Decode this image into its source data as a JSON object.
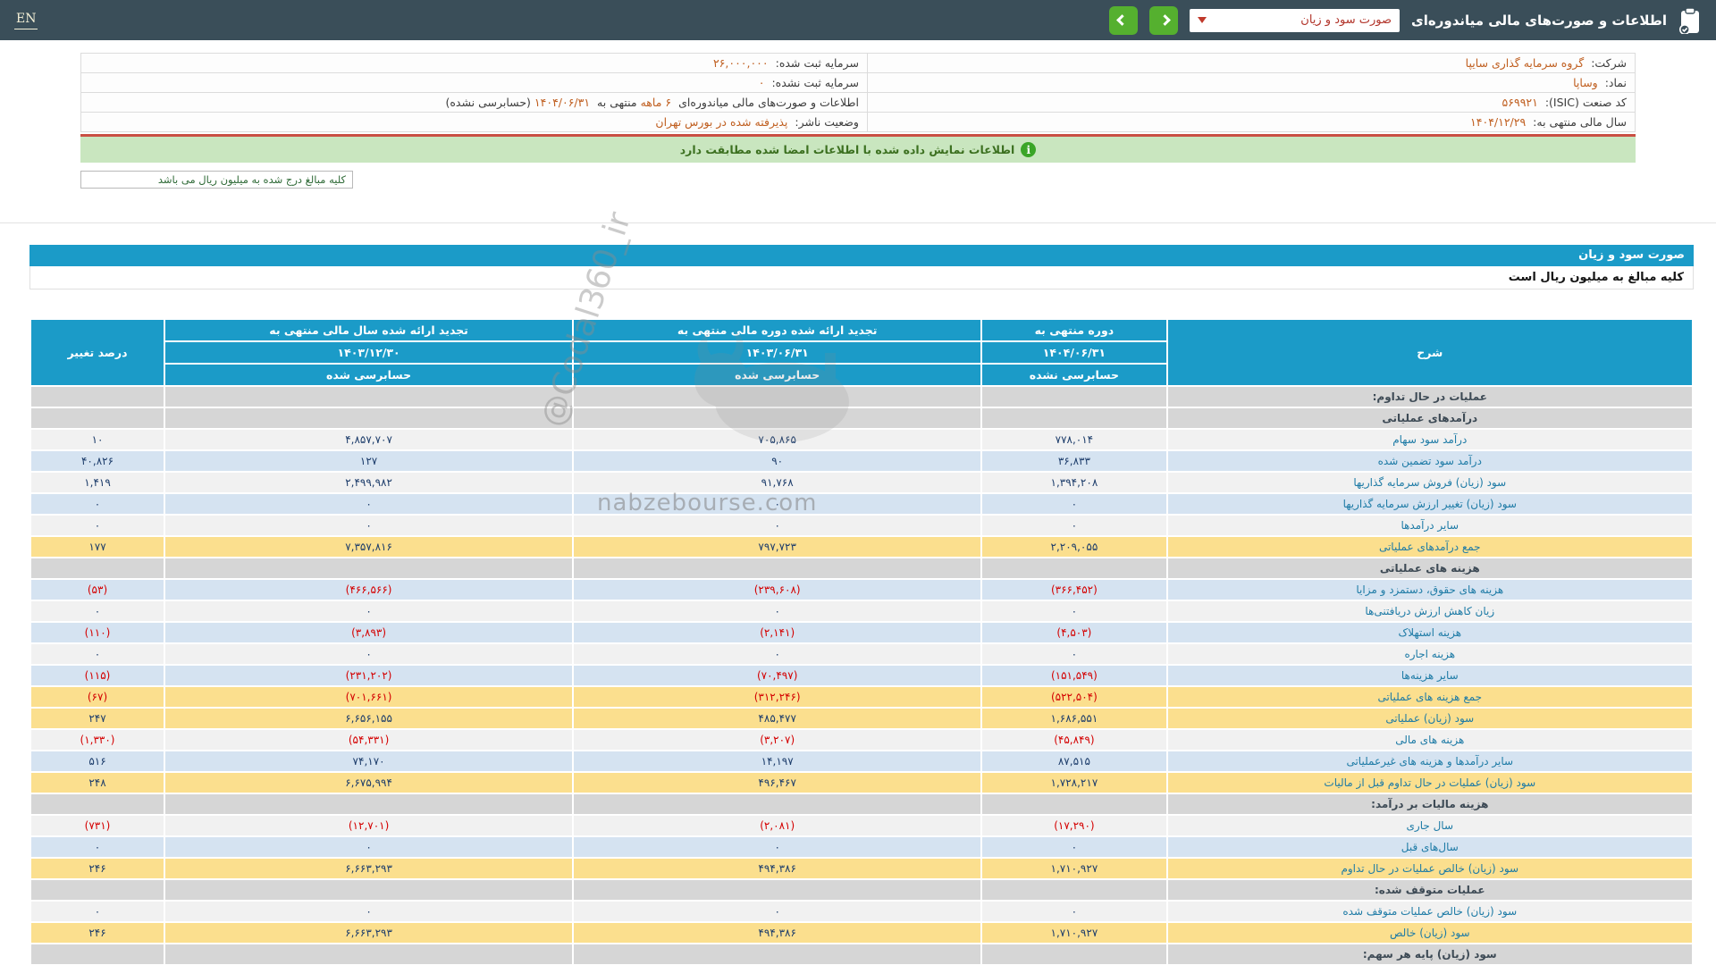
{
  "topbar": {
    "lang_label": "EN",
    "title": "اطلاعات و صورت‌های مالی میاندوره‌ای",
    "statement_select": {
      "value": "صورت سود و زیان"
    },
    "colors": {
      "bar_bg": "#3a4e59",
      "button_green": "#55b02f",
      "select_text": "#b2352b",
      "accent_blue": "#1b9bc8"
    }
  },
  "company": {
    "rows": [
      {
        "right": {
          "label": "شرکت:",
          "value": "گروه سرمایه گذاری سایپا"
        },
        "left": {
          "label": "سرمایه ثبت شده:",
          "value": "۲۶,۰۰۰,۰۰۰"
        }
      },
      {
        "right": {
          "label": "نماد:",
          "value": "وساپا"
        },
        "left": {
          "label": "سرمایه ثبت نشده:",
          "value": "۰"
        }
      },
      {
        "right": {
          "label": "کد صنعت (ISIC):",
          "value": "۵۶۹۹۲۱"
        },
        "left": {
          "p1": "اطلاعات و صورت‌های مالی میاندوره‌ای",
          "p2": "۶ ماهه",
          "p3": "منتهی به",
          "p4": "۱۴۰۴/۰۶/۳۱",
          "p5": "(حسابرسی نشده)"
        }
      },
      {
        "right": {
          "label": "سال مالی منتهی به:",
          "value": "۱۴۰۴/۱۲/۲۹"
        },
        "left": {
          "label": "وضعیت ناشر:",
          "value": "پذیرفته شده در بورس تهران"
        }
      }
    ]
  },
  "banner": {
    "text": "اطلاعات نمایش داده شده با اطلاعات امضا شده مطابقت دارد"
  },
  "note_box": {
    "text": "کلیه مبالغ درج شده به میلیون ریال می باشد"
  },
  "watermarks": {
    "site": "nabzebourse.com",
    "handle": "@Codal360_ir"
  },
  "statement": {
    "title": "صورت سود و زیان",
    "unit_note": "کلیه مبالغ به میلیون ریال است",
    "colors": {
      "highlight_yellow": "#fbdf8e",
      "row_blue": "#d5e3f1",
      "section_gray": "#d6d6d6",
      "negative_red": "#d40000",
      "value_navy": "#1d3d6b",
      "label_teal": "#1e7ba6"
    },
    "table": {
      "headers": {
        "description": "شرح",
        "col_current": {
          "line1": "دوره منتهی به",
          "date": "۱۴۰۴/۰۶/۳۱",
          "audit": "حسابرسی نشده"
        },
        "col_prior_period": {
          "line1": "تجدید ارائه شده دوره مالی منتهی به",
          "date": "۱۴۰۳/۰۶/۳۱",
          "audit": "حسابرسی شده"
        },
        "col_prior_year": {
          "line1": "تجدید ارائه شده سال مالی منتهی به",
          "date": "۱۴۰۳/۱۲/۳۰",
          "audit": "حسابرسی شده"
        },
        "change": "درصد تغییر"
      },
      "rows": [
        {
          "bg": "gray",
          "label": "عملیات در حال تداوم:"
        },
        {
          "bg": "gray",
          "label": "درآمدهای عملیاتی"
        },
        {
          "bg": "white",
          "label": "درآمد سود سهام",
          "v1": "۷۷۸,۰۱۴",
          "v2": "۷۰۵,۸۶۵",
          "v3": "۴,۸۵۷,۷۰۷",
          "pct": "۱۰"
        },
        {
          "bg": "blue",
          "label": "درآمد سود تضمین شده",
          "v1": "۳۶,۸۳۳",
          "v2": "۹۰",
          "v3": "۱۲۷",
          "pct": "۴۰,۸۲۶"
        },
        {
          "bg": "white",
          "label": "سود (زیان) فروش سرمایه گذاریها",
          "v1": "۱,۳۹۴,۲۰۸",
          "v2": "۹۱,۷۶۸",
          "v3": "۲,۴۹۹,۹۸۲",
          "pct": "۱,۴۱۹"
        },
        {
          "bg": "blue",
          "label": "سود (زیان) تغییر ارزش سرمایه گذاریها",
          "v1": "۰",
          "v2": "۰",
          "v3": "۰",
          "pct": "۰"
        },
        {
          "bg": "white",
          "label": "سایر درآمدها",
          "v1": "۰",
          "v2": "۰",
          "v3": "۰",
          "pct": "۰"
        },
        {
          "bg": "yellow",
          "label": "جمع درآمدهای عملیاتی",
          "v1": "۲,۲۰۹,۰۵۵",
          "v2": "۷۹۷,۷۲۳",
          "v3": "۷,۳۵۷,۸۱۶",
          "pct": "۱۷۷"
        },
        {
          "bg": "gray",
          "label": "هزینه های عملیاتی"
        },
        {
          "bg": "blue",
          "neg": true,
          "label": "هزینه های حقوق، دستمزد و مزایا",
          "v1": "(۳۶۶,۴۵۲)",
          "v2": "(۲۳۹,۶۰۸)",
          "v3": "(۴۶۶,۵۶۶)",
          "pct": "(۵۳)"
        },
        {
          "bg": "white",
          "label": "زیان کاهش ارزش دریافتنی‌ها",
          "v1": "۰",
          "v2": "۰",
          "v3": "۰",
          "pct": "۰"
        },
        {
          "bg": "blue",
          "neg": true,
          "label": "هزینه استهلاک",
          "v1": "(۴,۵۰۳)",
          "v2": "(۲,۱۴۱)",
          "v3": "(۳,۸۹۳)",
          "pct": "(۱۱۰)"
        },
        {
          "bg": "white",
          "label": "هزینه اجاره",
          "v1": "۰",
          "v2": "۰",
          "v3": "۰",
          "pct": "۰"
        },
        {
          "bg": "blue",
          "neg": true,
          "label": "سایر هزینه‌ها",
          "v1": "(۱۵۱,۵۴۹)",
          "v2": "(۷۰,۴۹۷)",
          "v3": "(۲۳۱,۲۰۲)",
          "pct": "(۱۱۵)"
        },
        {
          "bg": "yellow",
          "neg": true,
          "label": "جمع هزینه های عملیاتی",
          "v1": "(۵۲۲,۵۰۴)",
          "v2": "(۳۱۲,۲۴۶)",
          "v3": "(۷۰۱,۶۶۱)",
          "pct": "(۶۷)"
        },
        {
          "bg": "yellow",
          "label": "سود (زیان) عملیاتی",
          "v1": "۱,۶۸۶,۵۵۱",
          "v2": "۴۸۵,۴۷۷",
          "v3": "۶,۶۵۶,۱۵۵",
          "pct": "۲۴۷"
        },
        {
          "bg": "white",
          "neg": true,
          "label": "هزینه های مالی",
          "v1": "(۴۵,۸۴۹)",
          "v2": "(۳,۲۰۷)",
          "v3": "(۵۴,۳۳۱)",
          "pct": "(۱,۳۳۰)"
        },
        {
          "bg": "blue",
          "label": "سایر درآمدها و هزینه های غیرعملیاتی",
          "v1": "۸۷,۵۱۵",
          "v2": "۱۴,۱۹۷",
          "v3": "۷۴,۱۷۰",
          "pct": "۵۱۶"
        },
        {
          "bg": "yellow",
          "label": "سود (زیان) عملیات در حال تداوم قبل از مالیات",
          "v1": "۱,۷۲۸,۲۱۷",
          "v2": "۴۹۶,۴۶۷",
          "v3": "۶,۶۷۵,۹۹۴",
          "pct": "۲۴۸"
        },
        {
          "bg": "gray",
          "label": "هزینه مالیات بر درآمد:"
        },
        {
          "bg": "white",
          "neg": true,
          "label": "سال جاری",
          "v1": "(۱۷,۲۹۰)",
          "v2": "(۲,۰۸۱)",
          "v3": "(۱۲,۷۰۱)",
          "pct": "(۷۳۱)"
        },
        {
          "bg": "blue",
          "label": "سال‌های قبل",
          "v1": "۰",
          "v2": "۰",
          "v3": "۰",
          "pct": "۰"
        },
        {
          "bg": "yellow",
          "label": "سود (زیان) خالص عملیات در حال تداوم",
          "v1": "۱,۷۱۰,۹۲۷",
          "v2": "۴۹۴,۳۸۶",
          "v3": "۶,۶۶۳,۲۹۳",
          "pct": "۲۴۶"
        },
        {
          "bg": "gray",
          "label": "عملیات متوقف شده:"
        },
        {
          "bg": "white",
          "label": "سود (زیان) خالص عملیات متوقف شده",
          "v1": "۰",
          "v2": "۰",
          "v3": "۰",
          "pct": "۰"
        },
        {
          "bg": "yellow",
          "label": "سود (زیان) خالص",
          "v1": "۱,۷۱۰,۹۲۷",
          "v2": "۴۹۴,۳۸۶",
          "v3": "۶,۶۶۳,۲۹۳",
          "pct": "۲۴۶"
        },
        {
          "bg": "gray",
          "label": "سود (زیان) پایه هر سهم:",
          "partial": true
        }
      ]
    }
  }
}
